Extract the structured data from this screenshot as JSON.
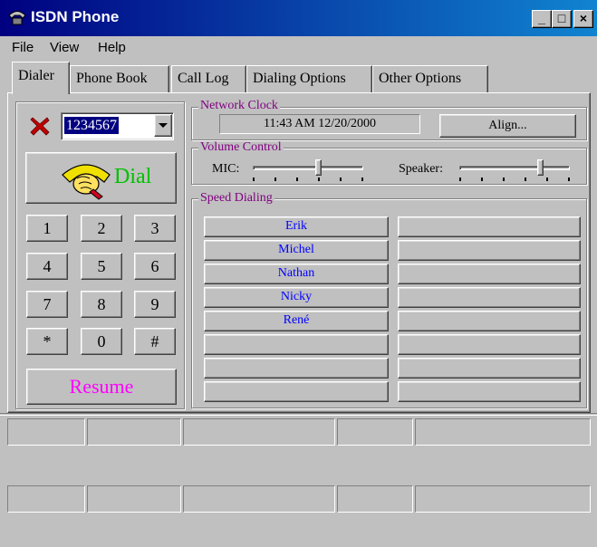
{
  "window": {
    "title": "ISDN Phone",
    "minimize_label": "_",
    "maximize_label": "□",
    "close_label": "×"
  },
  "menu": {
    "items": [
      "File",
      "View",
      "Help"
    ]
  },
  "tabs": [
    "Dialer",
    "Phone Book",
    "Call Log",
    "Dialing Options",
    "Other Options"
  ],
  "dialer": {
    "number_value": "1234567",
    "dial_label": "Dial",
    "resume_label": "Resume",
    "keys": [
      "1",
      "2",
      "3",
      "4",
      "5",
      "6",
      "7",
      "8",
      "9",
      "*",
      "0",
      "#"
    ]
  },
  "network_clock": {
    "label": "Network Clock",
    "time": "11:43 AM  12/20/2000",
    "align_label": "Align..."
  },
  "volume": {
    "label": "Volume Control",
    "mic_label": "MIC:",
    "speaker_label": "Speaker:",
    "mic_level": 0.6,
    "speaker_level": 0.75
  },
  "speed_dialing": {
    "label": "Speed Dialing",
    "left": [
      "Erik",
      "Michel",
      "Nathan",
      "Nicky",
      "René",
      "",
      "",
      ""
    ],
    "right": [
      "",
      "",
      "",
      "",
      "",
      "",
      "",
      ""
    ]
  },
  "colors": {
    "dial_text": "#00c000",
    "resume_text": "#ff00ff",
    "speed_text": "#0000ff",
    "group_label": "#800080",
    "title_start": "#000080",
    "title_end": "#1084d0"
  }
}
